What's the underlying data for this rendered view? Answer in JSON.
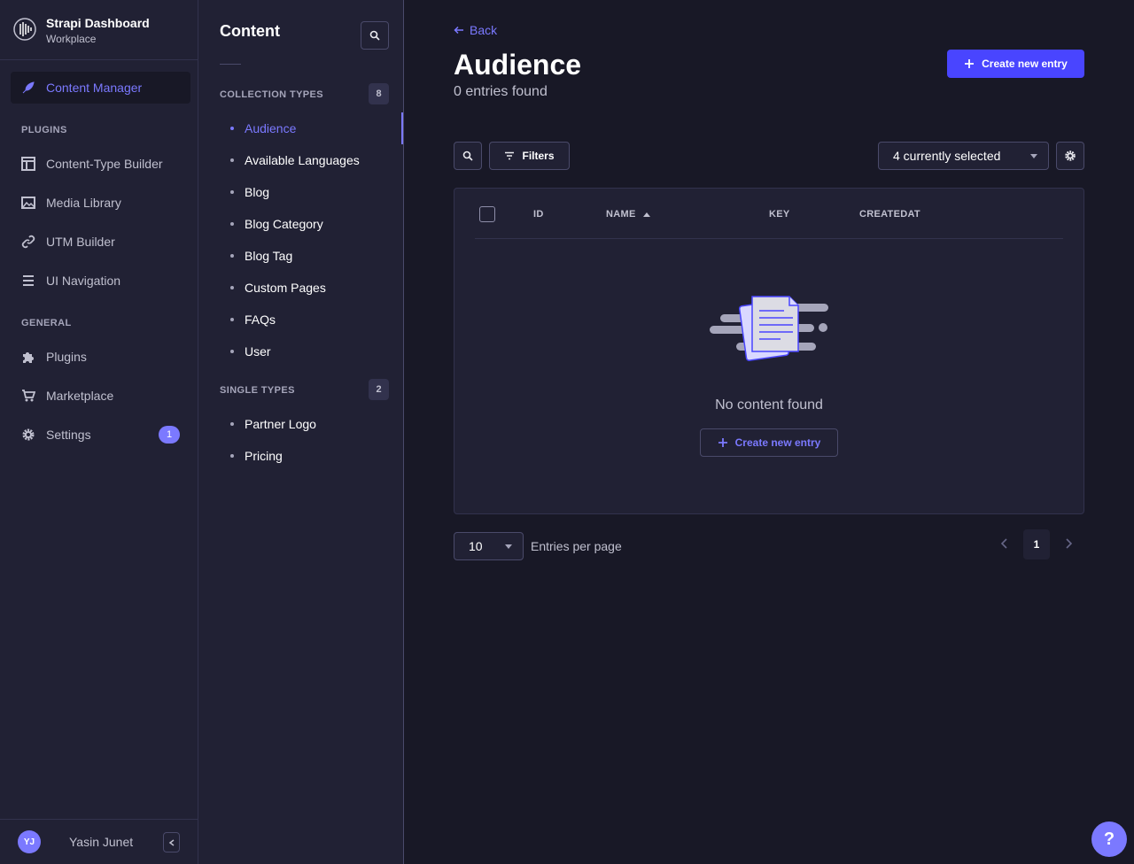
{
  "brand": {
    "title": "Strapi Dashboard",
    "subtitle": "Workplace"
  },
  "mainnav": {
    "content_manager": "Content Manager",
    "plugins_section": "PLUGINS",
    "plugins_items": [
      "Content-Type Builder",
      "Media Library",
      "UTM Builder",
      "UI Navigation"
    ],
    "general_section": "GENERAL",
    "general_items": [
      "Plugins",
      "Marketplace",
      "Settings"
    ],
    "settings_badge": "1"
  },
  "user": {
    "initials": "YJ",
    "name": "Yasin Junet"
  },
  "subnav": {
    "title": "Content",
    "collection_section": "COLLECTION TYPES",
    "collection_count": "8",
    "collection_items": [
      "Audience",
      "Available Languages",
      "Blog",
      "Blog Category",
      "Blog Tag",
      "Custom Pages",
      "FAQs",
      "User"
    ],
    "single_section": "SINGLE TYPES",
    "single_count": "2",
    "single_items": [
      "Partner Logo",
      "Pricing"
    ]
  },
  "header": {
    "back": "Back",
    "title": "Audience",
    "subtitle": "0 entries found",
    "create_button": "Create new entry"
  },
  "toolbar": {
    "filters": "Filters",
    "columns_select": "4 currently selected"
  },
  "table": {
    "columns": [
      "ID",
      "NAME",
      "KEY",
      "CREATEDAT"
    ],
    "sorted_column": "NAME",
    "empty_text": "No content found",
    "empty_button": "Create new entry"
  },
  "pagination": {
    "per_page_value": "10",
    "per_page_label": "Entries per page",
    "current_page": "1"
  },
  "help": {
    "label": "?"
  },
  "colors": {
    "accent": "#7b79ff",
    "primary": "#4945ff",
    "background": "#181826",
    "surface": "#212134"
  }
}
